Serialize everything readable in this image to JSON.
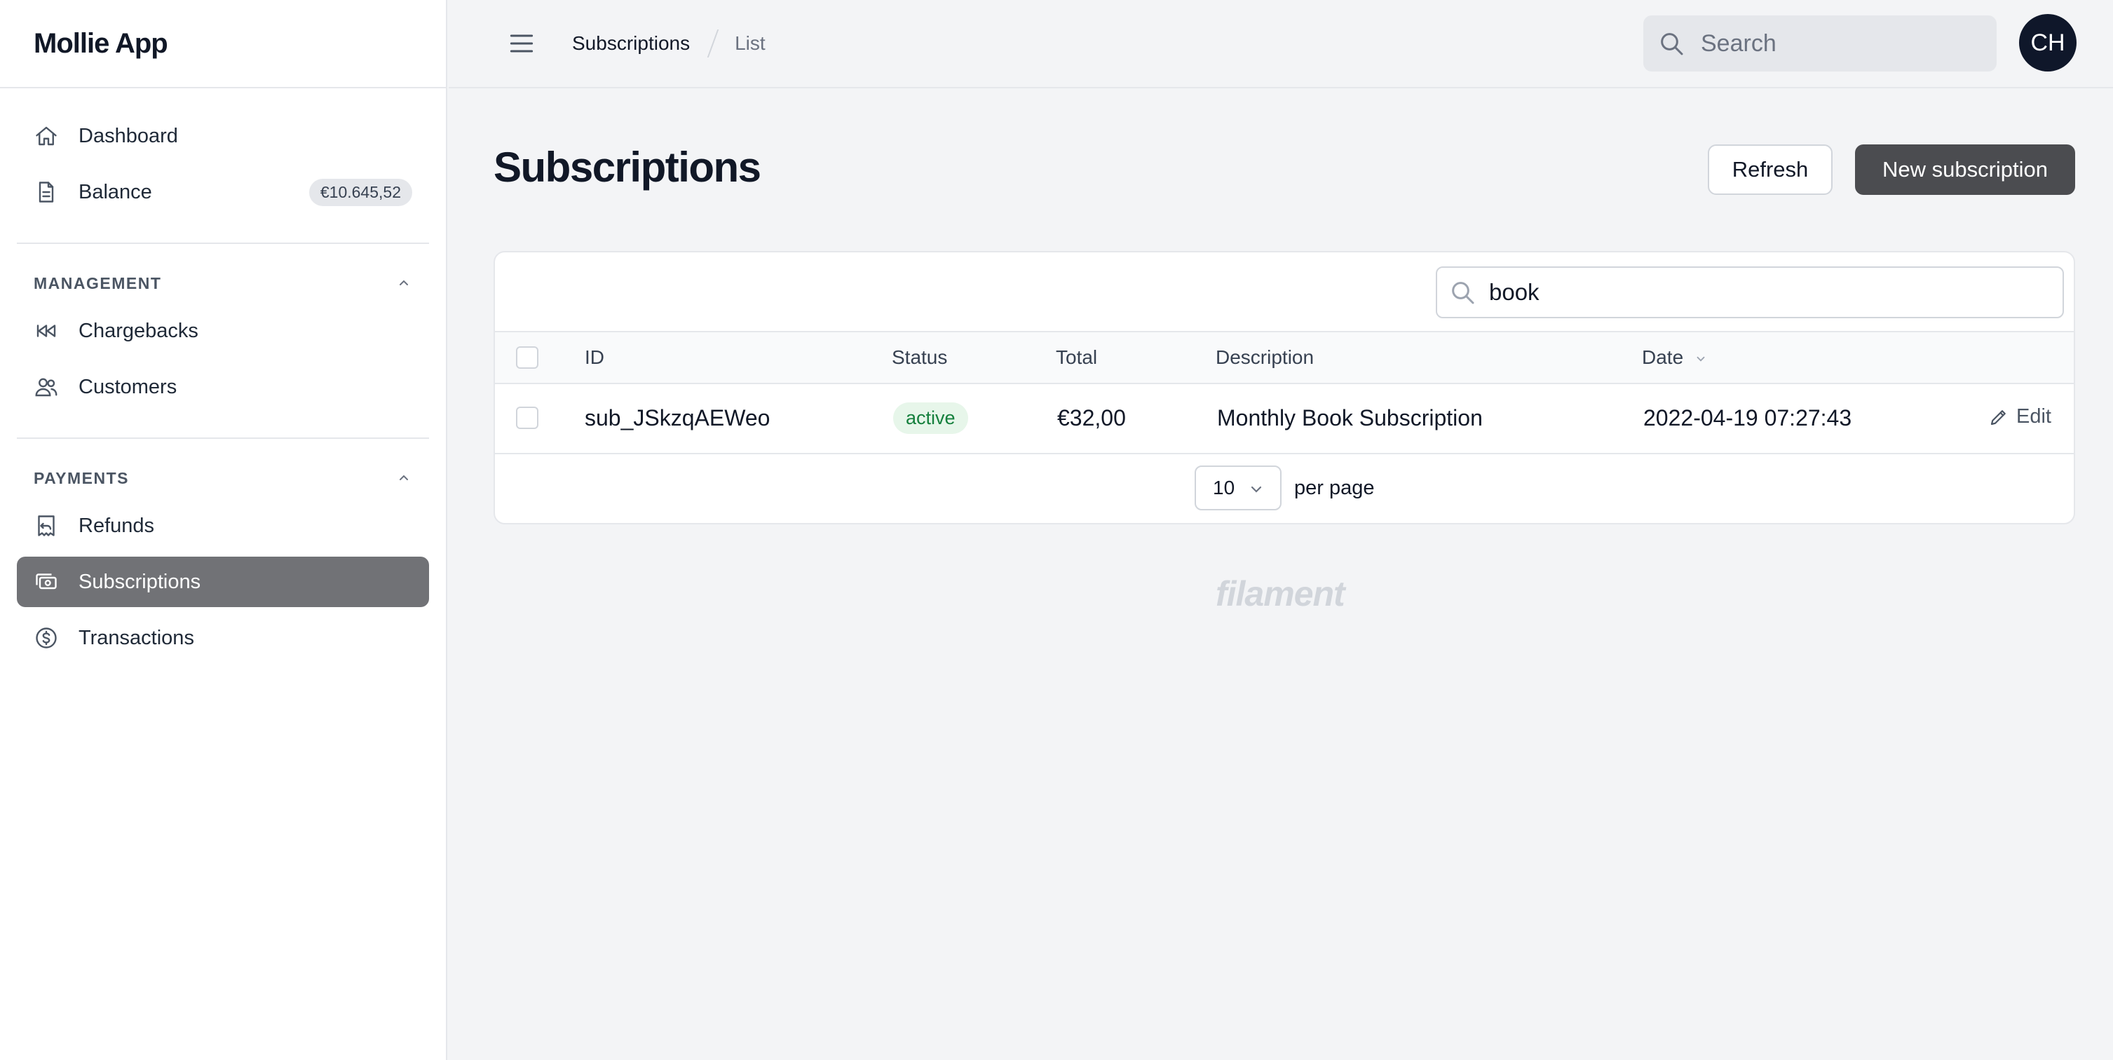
{
  "app": {
    "brand": "Mollie App"
  },
  "sidebar": {
    "top_items": [
      {
        "label": "Dashboard",
        "icon": "home-icon"
      },
      {
        "label": "Balance",
        "icon": "document-icon",
        "badge": "€10.645,52"
      }
    ],
    "groups": [
      {
        "title": "MANAGEMENT",
        "items": [
          {
            "label": "Chargebacks",
            "icon": "rewind-icon"
          },
          {
            "label": "Customers",
            "icon": "users-icon"
          }
        ]
      },
      {
        "title": "PAYMENTS",
        "items": [
          {
            "label": "Refunds",
            "icon": "receipt-refund-icon"
          },
          {
            "label": "Subscriptions",
            "icon": "cash-icon",
            "active": true
          },
          {
            "label": "Transactions",
            "icon": "currency-dollar-icon"
          }
        ]
      }
    ]
  },
  "topbar": {
    "breadcrumb": [
      "Subscriptions",
      "List"
    ],
    "search_placeholder": "Search",
    "avatar_initials": "CH"
  },
  "page": {
    "title": "Subscriptions",
    "refresh_label": "Refresh",
    "new_label": "New subscription"
  },
  "table": {
    "search_value": "book",
    "columns": [
      "ID",
      "Status",
      "Total",
      "Description",
      "Date"
    ],
    "rows": [
      {
        "id": "sub_JSkzqAEWeo",
        "status": "active",
        "total": "€32,00",
        "description": "Monthly Book Subscription",
        "date": "2022-04-19 07:27:43",
        "action": "Edit"
      }
    ],
    "per_page_value": "10",
    "per_page_label": "per page"
  },
  "footer": {
    "logo_text": "filament"
  },
  "colors": {
    "active_nav": "#717276",
    "primary_button": "#4b4c50",
    "status_active_bg": "#e7f6ea",
    "status_active_text": "#15803d"
  }
}
